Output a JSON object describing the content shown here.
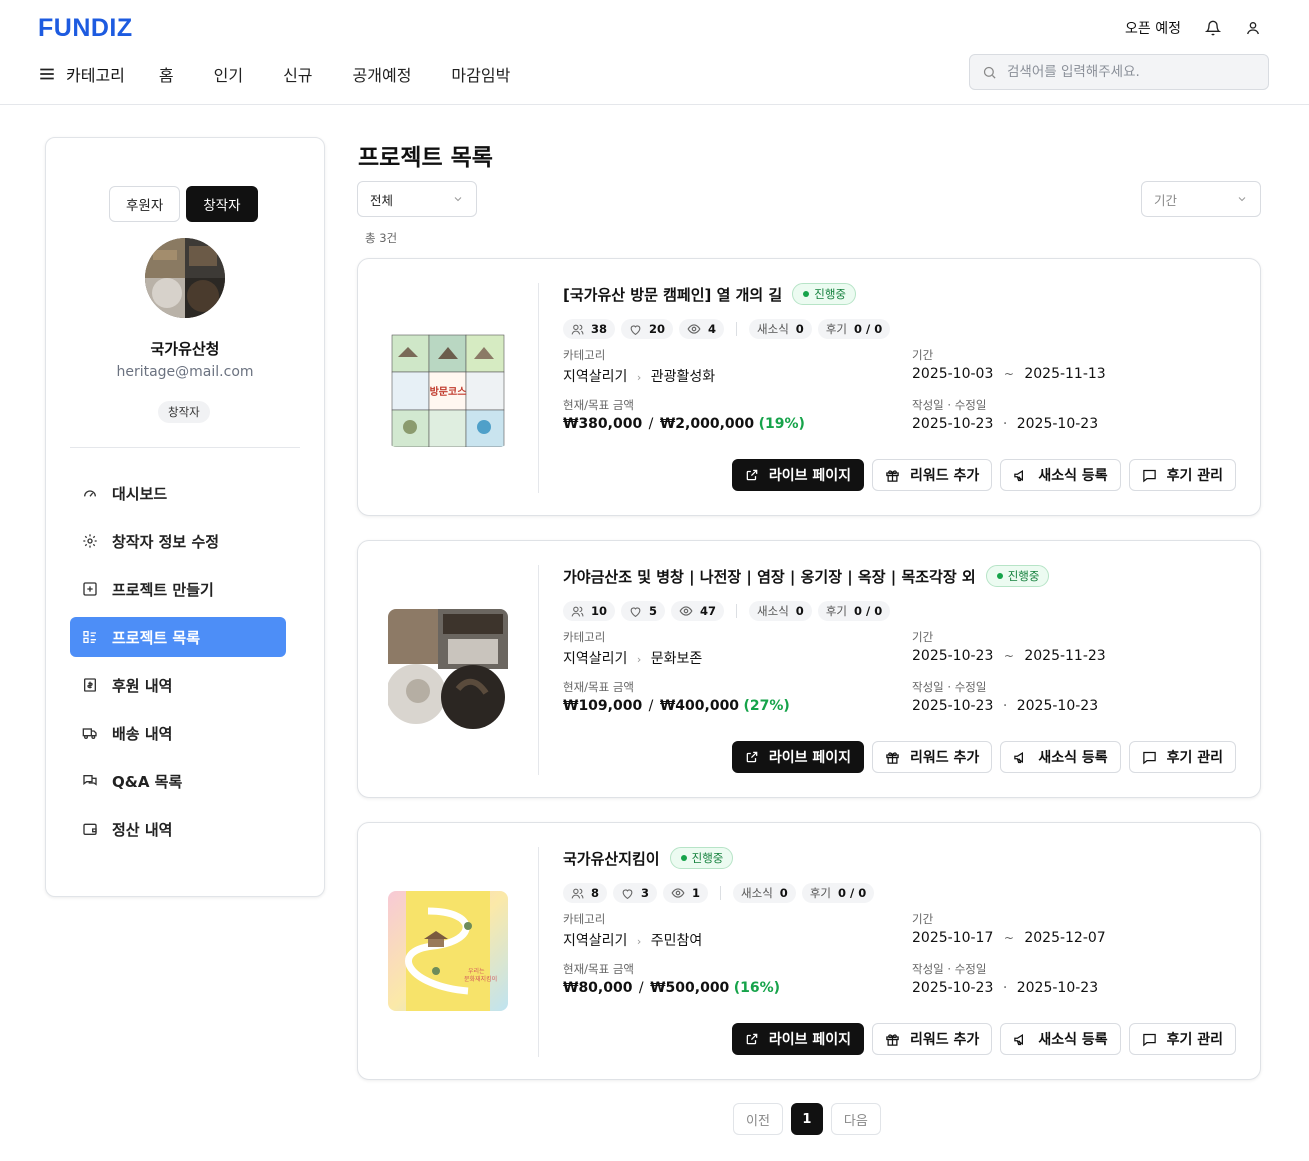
{
  "header": {
    "logo": "FUNDIZ",
    "open_soon": "오픈 예정",
    "category_label": "카테고리",
    "nav": [
      "홈",
      "인기",
      "신규",
      "공개예정",
      "마감임박"
    ],
    "search_placeholder": "검색어를 입력해주세요."
  },
  "sidebar": {
    "roles": [
      "후원자",
      "창작자"
    ],
    "active_role": "창작자",
    "profile_name": "국가유산청",
    "profile_email": "heritage@mail.com",
    "profile_badge": "창작자",
    "menu": [
      "대시보드",
      "창작자 정보 수정",
      "프로젝트 만들기",
      "프로젝트 목록",
      "후원 내역",
      "배송 내역",
      "Q&A 목록",
      "정산 내역"
    ],
    "active_menu": "프로젝트 목록"
  },
  "main": {
    "title": "프로젝트 목록",
    "filter_status": "전체",
    "filter_period": "기간",
    "total": "총 3건",
    "labels": {
      "category": "카테고리",
      "period": "기간",
      "amount": "현재/목표 금액",
      "dates": "작성일 · 수정일",
      "news": "새소식",
      "reviews": "후기"
    },
    "actions": [
      "라이브 페이지",
      "리워드 추가",
      "새소식 등록",
      "후기 관리"
    ],
    "projects": [
      {
        "title": "[국가유산 방문 캠페인] 열 개의 길",
        "status": "진행중",
        "supporters": "38",
        "likes": "20",
        "views": "4",
        "news": "0",
        "reviews": "0 / 0",
        "category_main": "지역살리기",
        "category_sub": "관광활성화",
        "period_start": "2025-10-03",
        "period_end": "2025-11-13",
        "current_amount": "₩380,000",
        "goal_amount": "₩2,000,000",
        "percent": "(19%)",
        "created": "2025-10-23",
        "modified": "2025-10-23"
      },
      {
        "title": "가야금산조 및 병창 | 나전장 | 염장 | 옹기장 | 옥장 | 목조각장 외",
        "status": "진행중",
        "supporters": "10",
        "likes": "5",
        "views": "47",
        "news": "0",
        "reviews": "0 / 0",
        "category_main": "지역살리기",
        "category_sub": "문화보존",
        "period_start": "2025-10-23",
        "period_end": "2025-11-23",
        "current_amount": "₩109,000",
        "goal_amount": "₩400,000",
        "percent": "(27%)",
        "created": "2025-10-23",
        "modified": "2025-10-23"
      },
      {
        "title": "국가유산지킴이",
        "status": "진행중",
        "supporters": "8",
        "likes": "3",
        "views": "1",
        "news": "0",
        "reviews": "0 / 0",
        "category_main": "지역살리기",
        "category_sub": "주민참여",
        "period_start": "2025-10-17",
        "period_end": "2025-12-07",
        "current_amount": "₩80,000",
        "goal_amount": "₩500,000",
        "percent": "(16%)",
        "created": "2025-10-23",
        "modified": "2025-10-23"
      }
    ]
  },
  "pagination": {
    "prev": "이전",
    "current": "1",
    "next": "다음"
  },
  "colors": {
    "brand": "#1d5be0",
    "active_menu": "#4d8ef7",
    "status_green": "#16a34a"
  }
}
